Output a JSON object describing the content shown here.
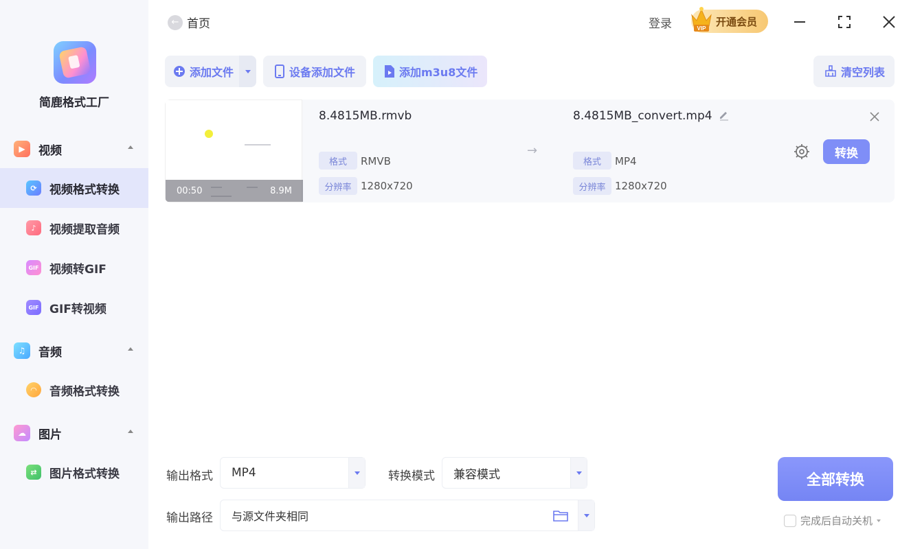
{
  "app": {
    "name": "简鹿格式工厂",
    "accent_color": "#7f8ef7"
  },
  "sidebar": {
    "groups": [
      {
        "label": "视频",
        "icon": "video-icon",
        "color": "#ff8a65",
        "items": [
          {
            "label": "视频格式转换",
            "icon": "video-convert-icon",
            "active": true
          },
          {
            "label": "视频提取音频",
            "icon": "extract-audio-icon"
          },
          {
            "label": "视频转GIF",
            "icon": "video-to-gif-icon"
          },
          {
            "label": "GIF转视频",
            "icon": "gif-to-video-icon"
          }
        ]
      },
      {
        "label": "音频",
        "icon": "audio-icon",
        "color": "#4fc3f7",
        "items": [
          {
            "label": "音频格式转换",
            "icon": "audio-convert-icon"
          }
        ]
      },
      {
        "label": "图片",
        "icon": "image-icon",
        "color": "#f06292",
        "items": [
          {
            "label": "图片格式转换",
            "icon": "image-convert-icon"
          }
        ]
      }
    ]
  },
  "header": {
    "back_label": "首页",
    "login_label": "登录",
    "vip_label": "开通会员",
    "vip_badge": "VIP"
  },
  "toolbar": {
    "add_file": "添加文件",
    "device_add": "设备添加文件",
    "add_m3u8": "添加m3u8文件",
    "clear_list": "清空列表"
  },
  "files": [
    {
      "thumb_duration": "00:50",
      "thumb_size": "8.9M",
      "source_name": "8.4815MB.rmvb",
      "source_format": "RMVB",
      "source_resolution": "1280x720",
      "target_name": "8.4815MB_convert.mp4",
      "target_format": "MP4",
      "target_resolution": "1280x720",
      "format_tag": "格式",
      "resolution_tag": "分辨率",
      "convert_label": "转换"
    }
  ],
  "bottom": {
    "output_format_label": "输出格式",
    "output_format_value": "MP4",
    "convert_mode_label": "转换模式",
    "convert_mode_value": "兼容模式",
    "output_path_label": "输出路径",
    "output_path_value": "与源文件夹相同",
    "convert_all_label": "全部转换",
    "shutdown_label": "完成后自动关机"
  }
}
